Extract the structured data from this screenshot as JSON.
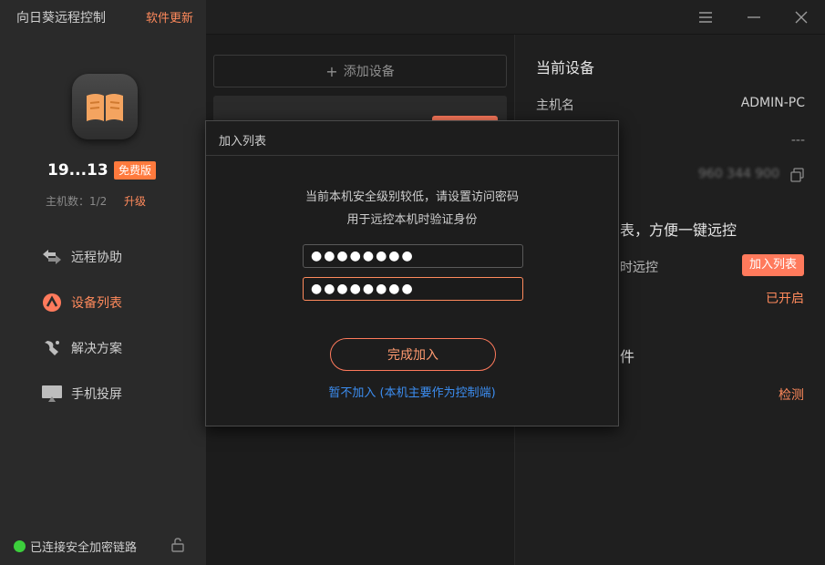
{
  "app": {
    "title": "向日葵远程控制",
    "update_label": "软件更新"
  },
  "profile": {
    "device_id": "19...13",
    "badge": "免费版",
    "host_count": "主机数：1/2",
    "upgrade": "升级"
  },
  "nav": [
    {
      "label": "远程协助",
      "icon": "remote-assist-icon"
    },
    {
      "label": "设备列表",
      "icon": "device-list-icon",
      "active": true
    },
    {
      "label": "解决方案",
      "icon": "solution-icon"
    },
    {
      "label": "手机投屏",
      "icon": "screen-cast-icon"
    }
  ],
  "status": {
    "text": "已连接安全加密链路"
  },
  "middle": {
    "add_device": "添加设备"
  },
  "right": {
    "title": "当前设备",
    "hostname_label": "主机名",
    "hostname_value": "ADMIN-PC",
    "dash_value": "---",
    "id_blurred": "960 344 900",
    "heading2": "表，方便一键远控",
    "remote_label": "时远控",
    "join_list_button": "加入列表",
    "enabled_text": "已开启",
    "heading3": "件",
    "detect": "检测"
  },
  "modal": {
    "title": "加入列表",
    "message_line1": "当前本机安全级别较低，请设置访问密码",
    "message_line2": "用于远控本机时验证身份",
    "password_mask": "●●●●●●●●",
    "confirm_mask": "●●●●●●●●",
    "finish_button": "完成加入",
    "skip_link": "暂不加入 (本机主要作为控制端)"
  },
  "colors": {
    "accent": "#ff7a5c",
    "link": "#3c8df0",
    "online": "#3ccf3c"
  }
}
